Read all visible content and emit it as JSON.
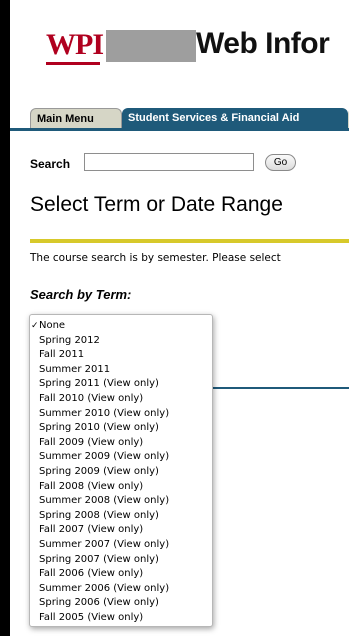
{
  "header": {
    "logo_text": "WPI",
    "site_title": "Web Infor"
  },
  "tabs": [
    {
      "label": "Main Menu"
    },
    {
      "label": "Student Services & Financial Aid"
    }
  ],
  "search": {
    "label": "Search",
    "value": "",
    "go_label": "Go"
  },
  "main": {
    "title": "Select Term or Date Range",
    "info_text": "The course search is by semester. Please select",
    "search_by_term_label": "Search by Term:"
  },
  "term_select": {
    "selected": "None",
    "options": [
      "None",
      "Spring 2012",
      "Fall 2011",
      "Summer 2011",
      "Spring 2011 (View only)",
      "Fall 2010 (View only)",
      "Summer 2010 (View only)",
      "Spring 2010 (View only)",
      "Fall 2009 (View only)",
      "Summer 2009 (View only)",
      "Spring 2009 (View only)",
      "Fall 2008 (View only)",
      "Summer 2008 (View only)",
      "Spring 2008 (View only)",
      "Fall 2007 (View only)",
      "Summer 2007 (View only)",
      "Spring 2007 (View only)",
      "Fall 2006 (View only)",
      "Summer 2006 (View only)",
      "Spring 2006 (View only)",
      "Fall 2005 (View only)"
    ]
  },
  "colors": {
    "brand_red": "#b0001f",
    "tab_blue": "#1f5a7a",
    "gold_rule": "#d7c92a"
  }
}
